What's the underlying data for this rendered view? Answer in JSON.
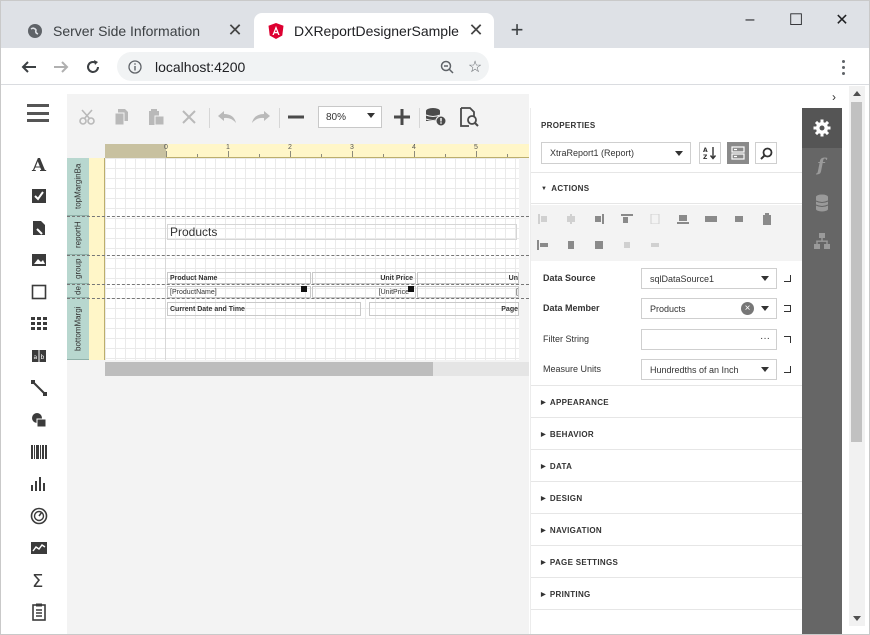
{
  "browser": {
    "tabs": [
      {
        "title": "Server Side Information",
        "icon": "globe-icon"
      },
      {
        "title": "DXReportDesignerSample",
        "icon": "angular-icon"
      }
    ],
    "url": "localhost:4200",
    "window_controls": {
      "minimize": "–",
      "maximize": "☐",
      "close": "✕"
    }
  },
  "designer": {
    "toolbar": {
      "zoom": "80%"
    },
    "ruler_numbers": [
      "1",
      "2",
      "3",
      "4",
      "5"
    ],
    "bands": [
      "topMarginBa",
      "reportH",
      "group",
      "de",
      "bottomMargi"
    ],
    "controls": {
      "title": "Products",
      "hdr_product_name": "Product Name",
      "hdr_unit_price": "Unit Price",
      "hdr_units": "Un",
      "val_product_name": "[ProductName]",
      "val_unit_price": "[UnitPrice",
      "val_units": "[",
      "footer_date": "Current Date and Time",
      "footer_page": "Page"
    }
  },
  "properties": {
    "title": "PROPERTIES",
    "object": "XtraReport1 (Report)",
    "sections": {
      "actions": "ACTIONS",
      "appearance": "APPEARANCE",
      "behavior": "BEHAVIOR",
      "data": "DATA",
      "design": "DESIGN",
      "navigation": "NAVIGATION",
      "page_settings": "PAGE SETTINGS",
      "printing": "PRINTING"
    },
    "rows": [
      {
        "label": "Data Source",
        "value": "sqlDataSource1"
      },
      {
        "label": "Data Member",
        "value": "Products"
      },
      {
        "label": "Filter String",
        "value": ""
      },
      {
        "label": "Measure Units",
        "value": "Hundredths of an Inch"
      }
    ]
  }
}
